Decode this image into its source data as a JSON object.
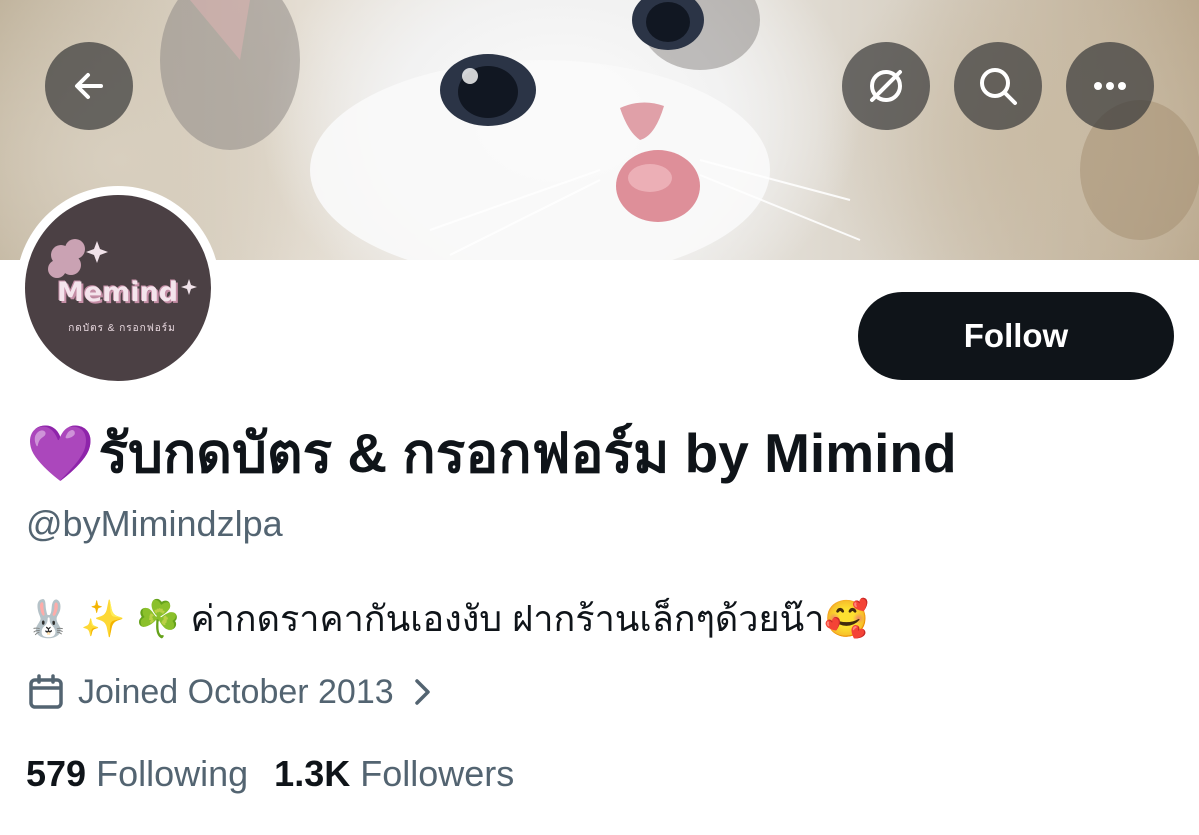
{
  "header": {
    "back_icon": "arrow-left-icon",
    "icons": [
      "grok-icon",
      "search-icon",
      "more-icon"
    ]
  },
  "avatar": {
    "logo_text": "Memind",
    "logo_subtext": "กดบัตร & กรอกฟอร์ม"
  },
  "actions": {
    "follow_label": "Follow"
  },
  "profile": {
    "name_emoji": "💜",
    "display_name": "รับกดบัตร & กรอกฟอร์ม by Mimind",
    "handle": "@byMimindzlpa",
    "bio": "🐰 ✨ ☘️  ค่ากดราคากันเองงับ ฝากร้านเล็กๆด้วยน๊า🥰",
    "joined": "Joined October 2013"
  },
  "stats": {
    "following_count": "579",
    "following_label": "Following",
    "followers_count": "1.3K",
    "followers_label": "Followers"
  },
  "colors": {
    "text_primary": "#0f1419",
    "text_secondary": "#536471",
    "follow_bg": "#0f1419",
    "avatar_bg": "#4b4044"
  }
}
